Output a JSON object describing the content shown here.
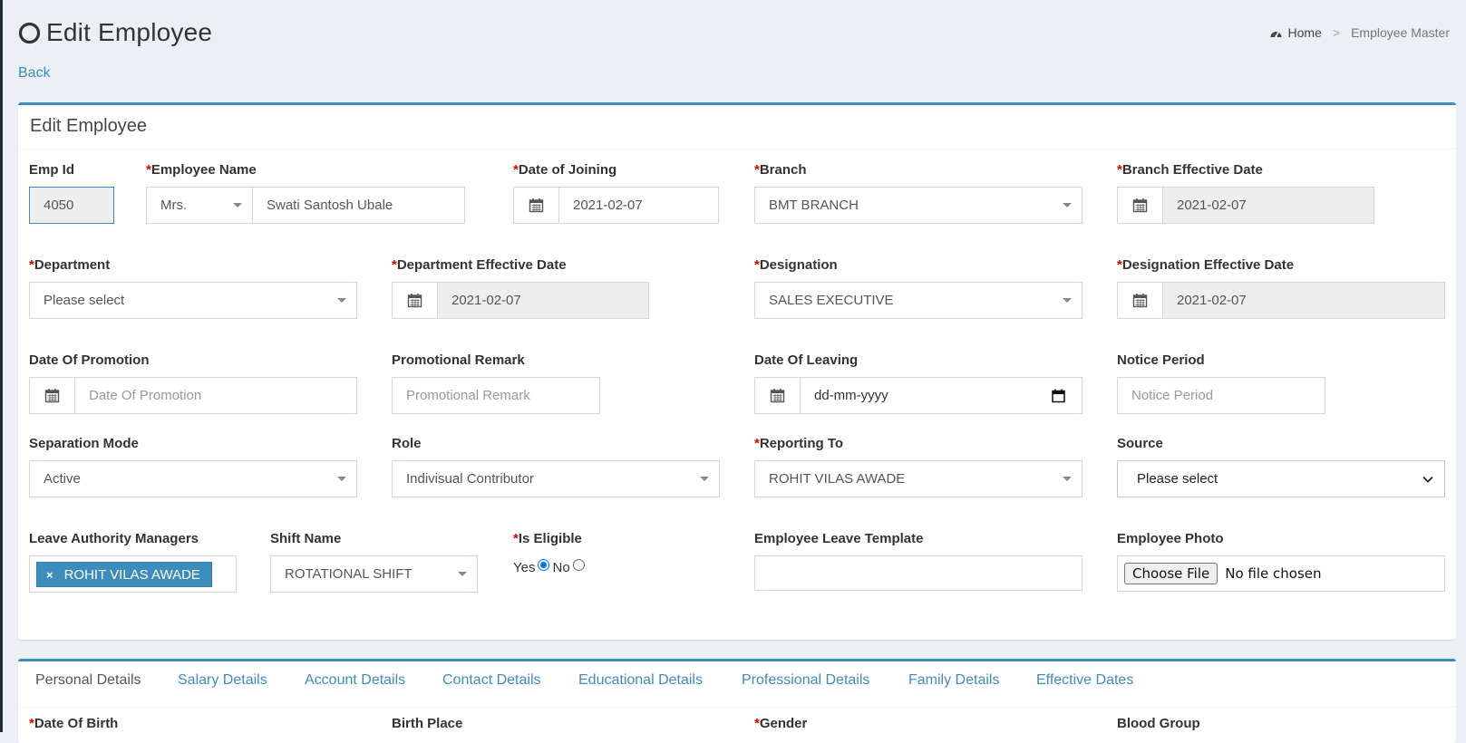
{
  "header": {
    "title": "Edit Employee",
    "back_label": "Back"
  },
  "breadcrumb": {
    "home": "Home",
    "separator": ">",
    "current": "Employee Master"
  },
  "form": {
    "title": "Edit Employee",
    "emp_id": {
      "label": "Emp Id",
      "value": "4050"
    },
    "employee_name": {
      "label": "Employee Name",
      "salutation": "Mrs.",
      "value": "Swati Santosh Ubale"
    },
    "date_of_joining": {
      "label": "Date of Joining",
      "value": "2021-02-07"
    },
    "branch": {
      "label": "Branch",
      "value": "BMT BRANCH"
    },
    "branch_effective_date": {
      "label": "Branch Effective Date",
      "value": "2021-02-07"
    },
    "department": {
      "label": "Department",
      "value": "Please select"
    },
    "department_effective_date": {
      "label": "Department Effective Date",
      "value": "2021-02-07"
    },
    "designation": {
      "label": "Designation",
      "value": "SALES EXECUTIVE"
    },
    "designation_effective_date": {
      "label": "Designation Effective Date",
      "value": "2021-02-07"
    },
    "date_of_promotion": {
      "label": "Date Of Promotion",
      "placeholder": "Date Of Promotion"
    },
    "promotional_remark": {
      "label": "Promotional Remark",
      "placeholder": "Promotional Remark"
    },
    "date_of_leaving": {
      "label": "Date Of Leaving",
      "placeholder": "dd-mm-yyyy"
    },
    "notice_period": {
      "label": "Notice Period",
      "placeholder": "Notice Period"
    },
    "separation_mode": {
      "label": "Separation Mode",
      "value": "Active"
    },
    "role": {
      "label": "Role",
      "value": "Indivisual Contributor"
    },
    "reporting_to": {
      "label": "Reporting To",
      "value": "ROHIT VILAS AWADE"
    },
    "source": {
      "label": "Source",
      "value": "Please select"
    },
    "leave_authority_managers": {
      "label": "Leave Authority Managers",
      "remove": "×",
      "chip": "ROHIT VILAS AWADE"
    },
    "shift_name": {
      "label": "Shift Name",
      "value": "ROTATIONAL SHIFT"
    },
    "is_eligible": {
      "label": "Is Eligible",
      "yes": "Yes",
      "no": "No",
      "selected": "Yes"
    },
    "employee_leave_template": {
      "label": "Employee Leave Template",
      "value": ""
    },
    "employee_photo": {
      "label": "Employee Photo",
      "button": "Choose File",
      "status": "No file chosen"
    },
    "required_mark": "*"
  },
  "tabs": [
    {
      "label": "Personal Details",
      "active": true
    },
    {
      "label": "Salary Details"
    },
    {
      "label": "Account Details"
    },
    {
      "label": "Contact Details"
    },
    {
      "label": "Educational Details"
    },
    {
      "label": "Professional Details"
    },
    {
      "label": "Family Details"
    },
    {
      "label": "Effective Dates"
    }
  ],
  "personal": {
    "date_of_birth": "Date Of Birth",
    "birth_place": "Birth Place",
    "gender": "Gender",
    "blood_group": "Blood Group"
  },
  "colors": {
    "accent": "#3c8dbc",
    "required": "#dd0000",
    "background": "#ecf0f5"
  }
}
